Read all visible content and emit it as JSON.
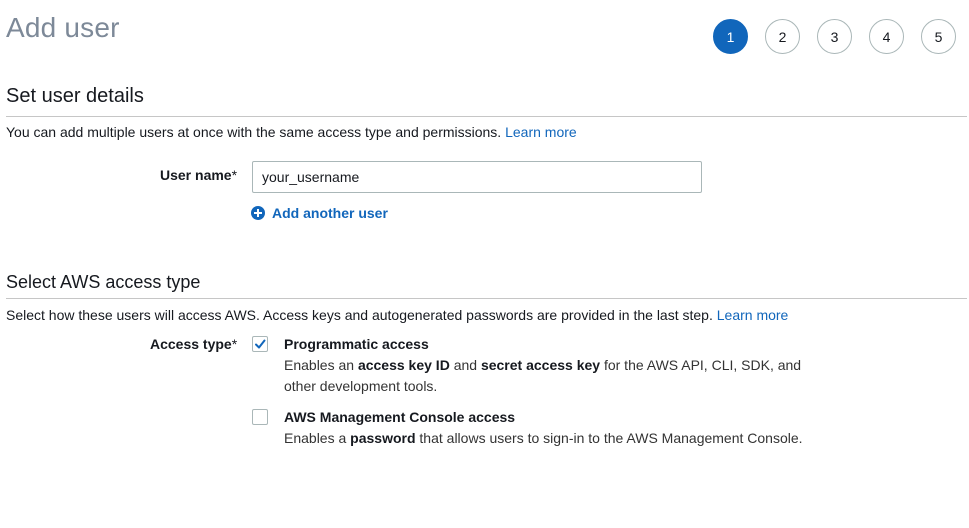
{
  "page": {
    "title": "Add user"
  },
  "steps": [
    {
      "label": "1",
      "active": true
    },
    {
      "label": "2",
      "active": false
    },
    {
      "label": "3",
      "active": false
    },
    {
      "label": "4",
      "active": false
    },
    {
      "label": "5",
      "active": false
    }
  ],
  "user_details": {
    "heading": "Set user details",
    "description": "You can add multiple users at once with the same access type and permissions.",
    "learn_more": "Learn more",
    "user_name_label": "User name",
    "required_mark": "*",
    "user_name_value": "your_username",
    "add_another_user": "Add another user"
  },
  "access_type": {
    "heading": "Select AWS access type",
    "description": "Select how these users will access AWS. Access keys and autogenerated passwords are provided in the last step.",
    "learn_more": "Learn more",
    "label": "Access type",
    "required_mark": "*",
    "options": [
      {
        "title": "Programmatic access",
        "checked": true,
        "desc_parts": [
          "Enables an ",
          "access key ID",
          " and ",
          "secret access key",
          " for the AWS API, CLI, SDK, and other development tools."
        ]
      },
      {
        "title": "AWS Management Console access",
        "checked": false,
        "desc_parts": [
          "Enables a ",
          "password",
          " that allows users to sign-in to the AWS Management Console."
        ]
      }
    ]
  },
  "colors": {
    "accent": "#1166bb",
    "title_gray": "#7d8998",
    "border": "#aab7b8"
  },
  "icons": {
    "add": "plus-circle-icon",
    "checked": "checkmark-icon"
  }
}
